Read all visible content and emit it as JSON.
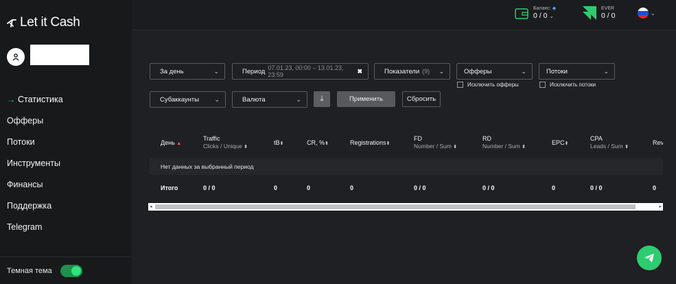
{
  "brand": {
    "name": "Let it Cash"
  },
  "sidebar": {
    "items": [
      {
        "label": "Статистика",
        "active": true
      },
      {
        "label": "Офферы"
      },
      {
        "label": "Потоки"
      },
      {
        "label": "Инструменты"
      },
      {
        "label": "Финансы"
      },
      {
        "label": "Поддержка"
      },
      {
        "label": "Telegram"
      }
    ],
    "theme_label": "Темная тема"
  },
  "header": {
    "balance_label": "Баланс",
    "balance_value": "0 / 0",
    "ever_label": "EVER",
    "ever_value": "0 / 0"
  },
  "filters": {
    "period_preset": "За день",
    "period_label": "Период",
    "period_value": "07.01.23, 00:00 – 13.01.23, 23:59",
    "indicators_label": "Показатели",
    "indicators_count": "(9)",
    "offers_label": "Офферы",
    "exclude_offers": "Исключить офферы",
    "streams_label": "Потоки",
    "exclude_streams": "Исключить потоки",
    "subaccounts_label": "Субаккаунты",
    "currency_label": "Валюта",
    "apply": "Применить",
    "reset": "Сбросить"
  },
  "table": {
    "columns": [
      {
        "title": "День",
        "sub": ""
      },
      {
        "title": "Traffic",
        "sub": "Clicks / Unique"
      },
      {
        "title": "tB",
        "sub": ""
      },
      {
        "title": "CR, %",
        "sub": ""
      },
      {
        "title": "Registrations",
        "sub": ""
      },
      {
        "title": "FD",
        "sub": "Number / Sum"
      },
      {
        "title": "RD",
        "sub": "Number / Sum"
      },
      {
        "title": "EPC",
        "sub": ""
      },
      {
        "title": "CPA",
        "sub": "Leads / Sum"
      },
      {
        "title": "Rev",
        "sub": ""
      }
    ],
    "empty_message": "Нет данных за выбранный период",
    "totals": [
      "Итого",
      "0 / 0",
      "0",
      "0",
      "0",
      "0 / 0",
      "0 / 0",
      "0",
      "0 / 0",
      "0"
    ]
  },
  "colors": {
    "accent": "#2ecc71",
    "background": "#1f2024",
    "sidebar": "#18191b"
  },
  "icons": [
    "send-icon",
    "wallet-icon",
    "ever-logo-icon",
    "ru-flag-icon",
    "download-icon",
    "user-icon"
  ]
}
